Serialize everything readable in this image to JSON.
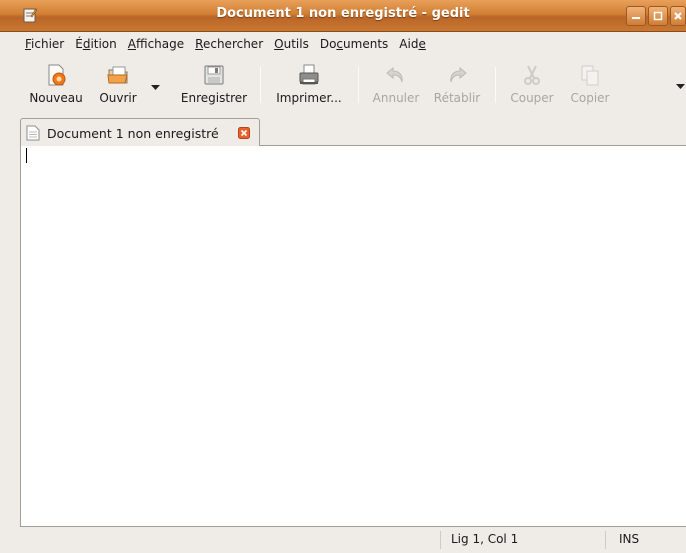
{
  "window": {
    "title": "Document 1 non enregistré - gedit",
    "accent": "#d27f33"
  },
  "menu": [
    {
      "pre": "",
      "acc": "F",
      "post": "ichier"
    },
    {
      "pre": "É",
      "acc": "d",
      "post": "ition"
    },
    {
      "pre": "",
      "acc": "A",
      "post": "ffichage"
    },
    {
      "pre": "",
      "acc": "R",
      "post": "echercher"
    },
    {
      "pre": "",
      "acc": "O",
      "post": "utils"
    },
    {
      "pre": "Do",
      "acc": "c",
      "post": "uments"
    },
    {
      "pre": "Aid",
      "acc": "e",
      "post": ""
    }
  ],
  "toolbar": {
    "new_label": "Nouveau",
    "open_label": "Ouvrir",
    "save_label": "Enregistrer",
    "print_label": "Imprimer...",
    "undo_label": "Annuler",
    "redo_label": "Rétablir",
    "cut_label": "Couper",
    "copy_label": "Copier"
  },
  "tab": {
    "label": "Document 1 non enregistré"
  },
  "editor": {
    "content": ""
  },
  "status": {
    "position": "Lig 1, Col 1",
    "mode": "INS"
  }
}
